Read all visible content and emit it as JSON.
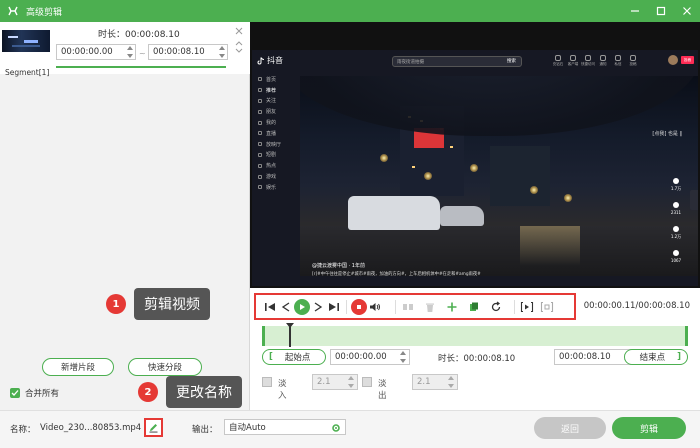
{
  "window": {
    "title": "高级剪辑",
    "accent": "#4caf50"
  },
  "segment": {
    "duration_label": "时长：",
    "duration": "00:00:08.10",
    "start": "00:00:00.00",
    "end": "00:00:08.10",
    "tilde": "~",
    "name": "Segment[1]"
  },
  "left_buttons": {
    "add_segment": "新增片段",
    "quick_split": "快速分段",
    "merge_all": "合并所有",
    "merge_checked": true
  },
  "callouts": [
    {
      "num": "1",
      "text": "剪辑视频"
    },
    {
      "num": "2",
      "text": "更改名称"
    }
  ],
  "player": {
    "logo": "抖音",
    "search_placeholder": "雨夜街道拍摄",
    "search_button": "搜索",
    "nav": [
      "首页",
      "推荐",
      "关注",
      "朋友",
      "我的",
      "直播",
      "放映厅",
      "短剧",
      "热点",
      "游戏",
      "娱乐"
    ],
    "active_nav": 1,
    "top_icons": [
      "充钻石",
      "客户端",
      "快捷访问",
      "通知",
      "私信",
      "投稿"
    ],
    "post_label": "投稿",
    "user_tag": "[点我] 也是 ‖",
    "author": "@捷云渡雾中国 · 1年前",
    "caption": "[r]#中午往往是停止#城市#雨夜，加油的方向#，上车后相机体中#在走和#amg雨夜#",
    "actions": [
      {
        "icon": "heart-icon",
        "count": "1.7万"
      },
      {
        "icon": "comment-icon",
        "count": "2311"
      },
      {
        "icon": "star-icon",
        "count": "1.2万"
      },
      {
        "icon": "share-icon",
        "count": "1067"
      }
    ]
  },
  "controls": {
    "current_time": "00:00:00.11",
    "total_time": "00:00:08.10",
    "time_sep": "/"
  },
  "trim": {
    "start_label": "起始点",
    "start_time": "00:00:00.00",
    "duration_label": "时长：",
    "duration": "00:00:08.10",
    "end_time": "00:00:08.10",
    "end_label": "结束点",
    "bracket_open": "[",
    "bracket_close": "]"
  },
  "fade": {
    "fade_in_label": "淡入",
    "fade_in_value": "2.1",
    "fade_out_label": "淡出",
    "fade_out_value": "2.1"
  },
  "bottom": {
    "name_label": "名称：",
    "name_value": "Video_230...80853.mp4",
    "output_label": "输出：",
    "output_value": "自动Auto",
    "back_button": "返回",
    "edit_button": "剪辑"
  }
}
